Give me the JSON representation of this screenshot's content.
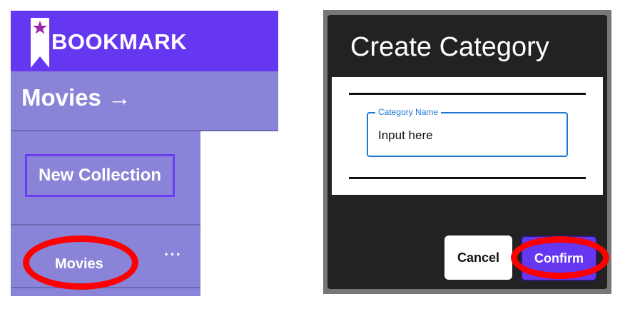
{
  "brand": {
    "name": "BOOKMARK",
    "icon": "bookmark-star-icon"
  },
  "header": {
    "title": "Movies →"
  },
  "sidebar": {
    "new_collection_label": "New Collection",
    "categories": [
      {
        "label": "Movies",
        "menu_label": "···"
      }
    ]
  },
  "dialog": {
    "title": "Create Category",
    "field": {
      "label": "Category Name",
      "value": "Input here"
    },
    "cancel_label": "Cancel",
    "confirm_label": "Confirm"
  },
  "colors": {
    "brand": "#6637f1",
    "panel": "#8a84d8",
    "dialog_bg": "#222222",
    "field_accent": "#1e77d2",
    "highlight": "#ff0000"
  }
}
